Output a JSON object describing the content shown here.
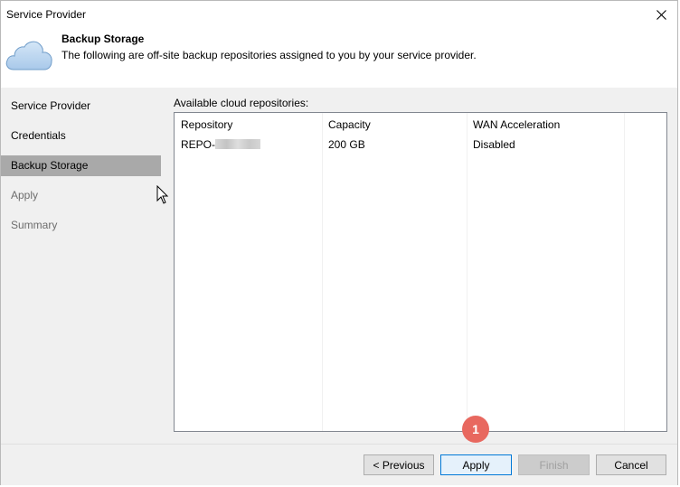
{
  "window": {
    "title": "Service Provider"
  },
  "header": {
    "title": "Backup Storage",
    "description": "The following are off-site backup repositories assigned to you by your service provider."
  },
  "sidebar": {
    "items": [
      {
        "label": "Service Provider",
        "state": "normal"
      },
      {
        "label": "Credentials",
        "state": "normal"
      },
      {
        "label": "Backup Storage",
        "state": "active"
      },
      {
        "label": "Apply",
        "state": "disabled"
      },
      {
        "label": "Summary",
        "state": "disabled"
      }
    ]
  },
  "content": {
    "label": "Available cloud repositories:",
    "columns": [
      "Repository",
      "Capacity",
      "WAN Acceleration"
    ],
    "rows": [
      {
        "repository": "REPO-",
        "capacity": "200 GB",
        "wan": "Disabled"
      }
    ]
  },
  "footer": {
    "previous": "< Previous",
    "apply": "Apply",
    "finish": "Finish",
    "cancel": "Cancel"
  },
  "annotation": {
    "badge": "1",
    "color": "#e8685f"
  }
}
